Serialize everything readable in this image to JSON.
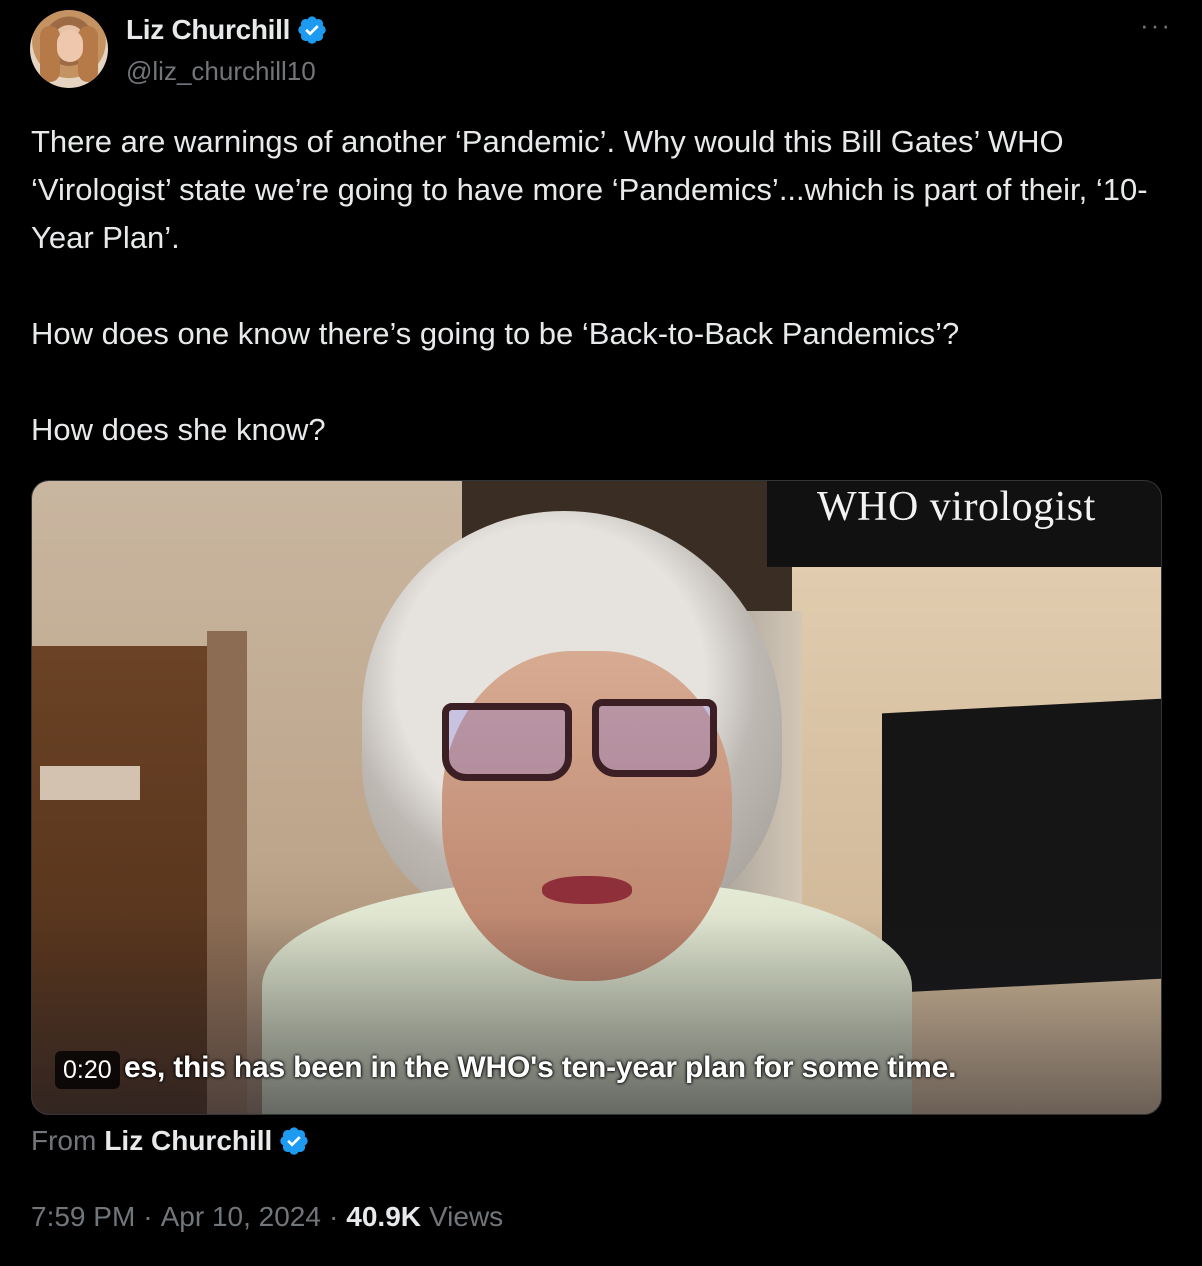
{
  "author": {
    "display_name": "Liz Churchill",
    "handle": "@liz_churchill10",
    "verified": true
  },
  "more_icon": "ellipsis-icon",
  "tweet": {
    "paragraphs": [
      "There are warnings of another ‘Pandemic’. Why would this Bill Gates’ WHO ‘Virologist’ state we’re going to have more ‘Pandemics’...which is part of their, ‘10-Year Plan’.",
      "How does one know there’s going to be ‘Back-to-Back Pandemics’?",
      "How does she know?"
    ]
  },
  "media": {
    "overlay_label": "WHO virologist",
    "caption": "es, this has been in the WHO's ten-year plan for some time.",
    "timestamp": "0:20"
  },
  "source": {
    "prefix": "From",
    "name": "Liz Churchill"
  },
  "meta": {
    "time": "7:59 PM",
    "separator": "·",
    "date": "Apr 10, 2024",
    "views_count": "40.9K",
    "views_label": "Views"
  },
  "colors": {
    "background": "#000000",
    "text_primary": "#e7e9ea",
    "text_secondary": "#71767b",
    "verified_blue": "#1d9bf0"
  }
}
